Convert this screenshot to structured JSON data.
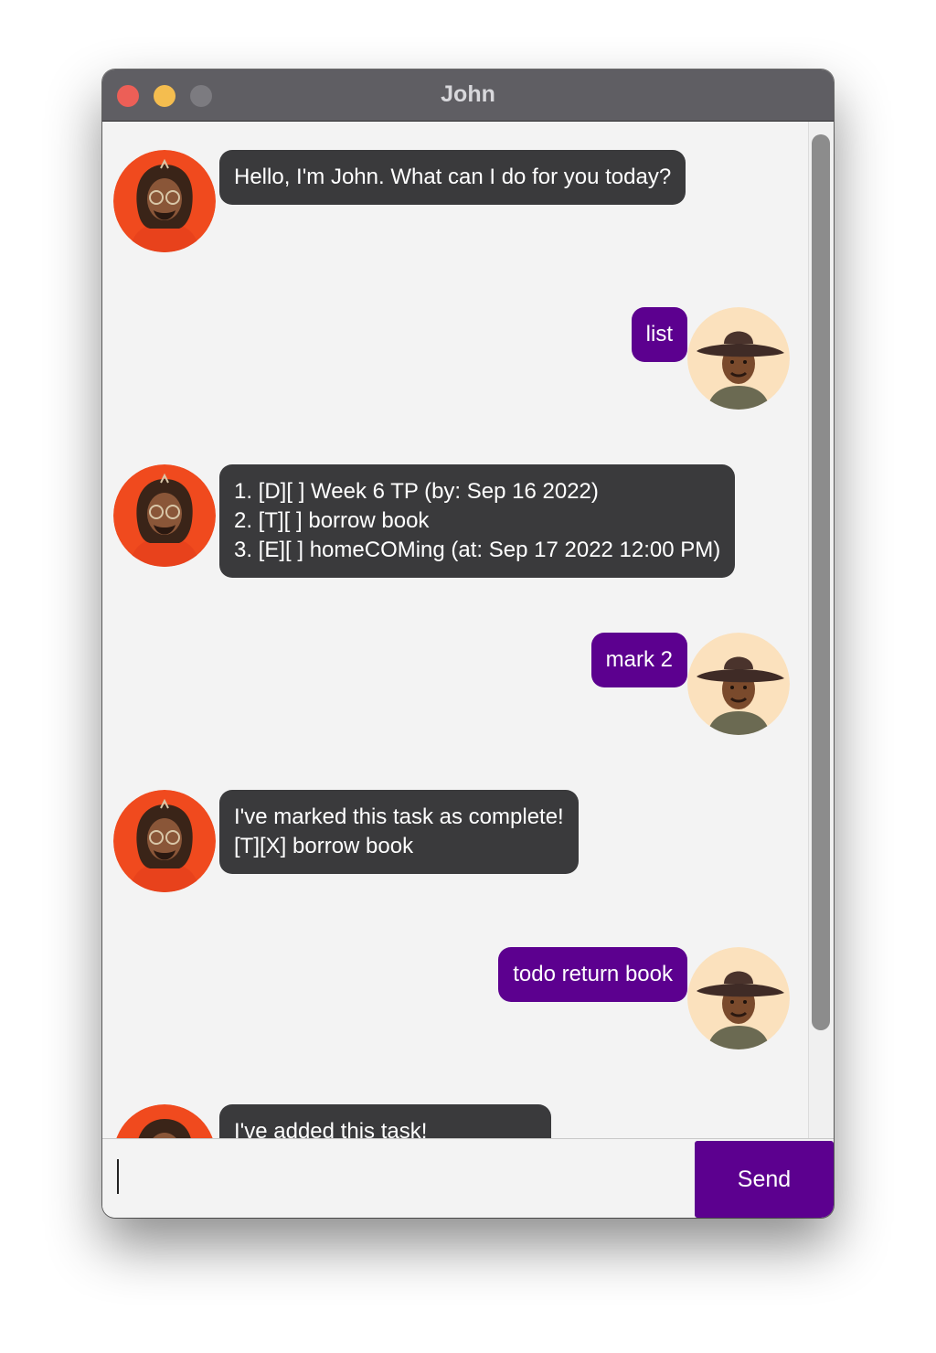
{
  "window": {
    "title": "John"
  },
  "colors": {
    "bot_bubble": "#3a3a3c",
    "user_bubble": "#5c008f",
    "send_button": "#5c008f",
    "bot_avatar_bg": "#f04a1e",
    "user_avatar_bg": "#fbe1bd"
  },
  "messages": [
    {
      "sender": "bot",
      "avatar": "bot-avatar",
      "text": "Hello, I'm John. What can I do for you today?"
    },
    {
      "sender": "user",
      "avatar": "user-avatar",
      "text": "list"
    },
    {
      "sender": "bot",
      "avatar": "bot-avatar",
      "text": "1. [D][ ] Week 6 TP (by: Sep 16 2022)\n2. [T][ ] borrow book\n3. [E][ ] homeCOMing (at: Sep 17 2022 12:00 PM)"
    },
    {
      "sender": "user",
      "avatar": "user-avatar",
      "text": "mark 2"
    },
    {
      "sender": "bot",
      "avatar": "bot-avatar",
      "text": "I've marked this task as complete!\n[T][X] borrow book"
    },
    {
      "sender": "user",
      "avatar": "user-avatar",
      "text": "todo return book"
    },
    {
      "sender": "bot",
      "avatar": "bot-avatar",
      "text": "I've added this task!"
    }
  ],
  "input": {
    "value": "",
    "send_label": "Send"
  }
}
